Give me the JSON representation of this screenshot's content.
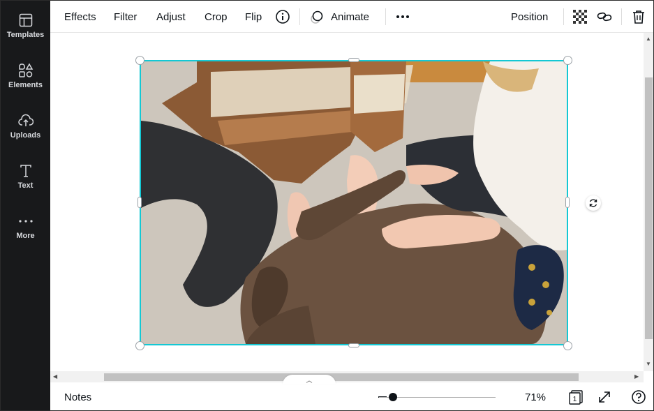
{
  "sidebar": {
    "items": [
      {
        "label": "Templates",
        "icon": "templates-icon"
      },
      {
        "label": "Elements",
        "icon": "elements-icon"
      },
      {
        "label": "Uploads",
        "icon": "uploads-icon"
      },
      {
        "label": "Text",
        "icon": "text-icon"
      },
      {
        "label": "More",
        "icon": "more-icon"
      }
    ]
  },
  "toolbar": {
    "effects": "Effects",
    "filter": "Filter",
    "adjust": "Adjust",
    "crop": "Crop",
    "flip": "Flip",
    "animate": "Animate",
    "position": "Position"
  },
  "bottom": {
    "notes": "Notes",
    "zoom": "71%",
    "page_count": "1"
  },
  "colors": {
    "sidebar_bg": "#18191b",
    "selection": "#14c8d4"
  }
}
